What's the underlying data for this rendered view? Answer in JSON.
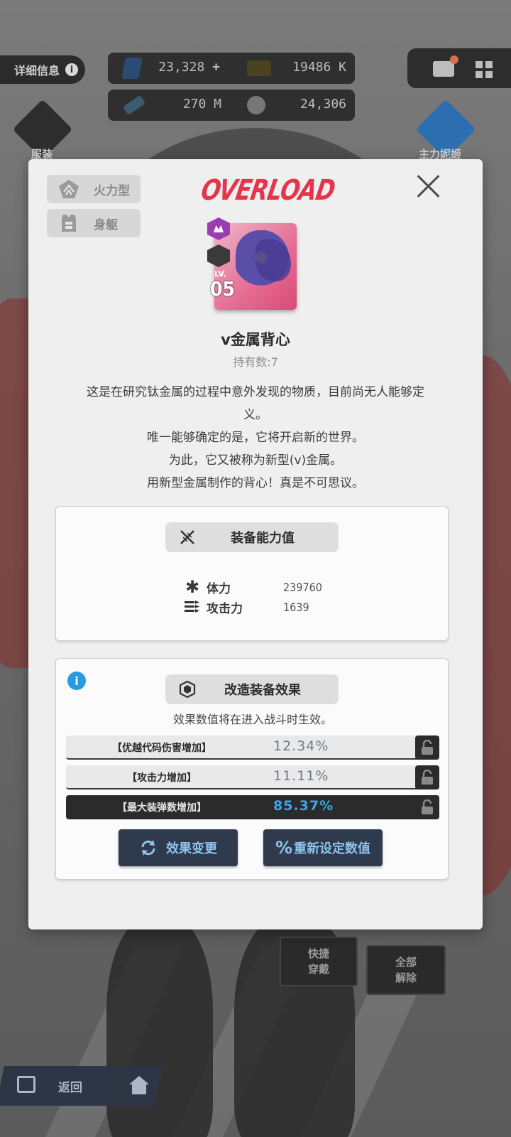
{
  "hud": {
    "info_label": "详细信息",
    "info_icon": "i",
    "resources": [
      {
        "value": "23,328",
        "plus": "+"
      },
      {
        "value": "19486 K"
      },
      {
        "value": "270 M"
      },
      {
        "value": "24,306"
      }
    ],
    "left_button_label": "服装",
    "right_button_label": "主力妮姬"
  },
  "modal": {
    "tags": [
      {
        "label": "火力型",
        "icon": "firepower-icon"
      },
      {
        "label": "身躯",
        "icon": "armor-body-icon"
      }
    ],
    "banner": "OVERLOAD",
    "item": {
      "level_label": "LV.",
      "level": "05",
      "name": "v金属背心",
      "owned_label": "持有数:",
      "owned_count": "7",
      "description": [
        "这是在研究钛金属的过程中意外发现的物质，目前尚无人能够定",
        "义。",
        "唯一能够确定的是，它将开启新的世界。",
        "为此，它又被称为新型(v)金属。",
        "用新型金属制作的背心！真是不可思议。"
      ]
    },
    "stats_panel": {
      "title": "装备能力值",
      "stats": [
        {
          "label": "体力",
          "value": "239760",
          "icon": "asterisk-icon"
        },
        {
          "label": "攻击力",
          "value": "1639",
          "icon": "bullets-icon"
        }
      ]
    },
    "effects_panel": {
      "title": "改造装备效果",
      "hint": "效果数值将在进入战斗时生效。",
      "effects": [
        {
          "name": "【优越代码伤害增加】",
          "value": "12.34%",
          "style": "light"
        },
        {
          "name": "【攻击力增加】",
          "value": "11.11%",
          "style": "light"
        },
        {
          "name": "【最大装弹数增加】",
          "value": "85.37%",
          "style": "dark"
        }
      ],
      "buttons": {
        "change": "效果变更",
        "reset_symbol": "%",
        "reset": "重新设定数值"
      }
    }
  },
  "bottom": {
    "quick_equip": [
      "快捷",
      "穿戴"
    ],
    "unequip_all": [
      "全部",
      "解除"
    ],
    "back": "返回"
  },
  "colors": {
    "accent_red": "#e4354a",
    "accent_blue": "#3aa6e8",
    "button_bg": "#2f3a4d",
    "rarity_purple": "#9b3db0"
  }
}
